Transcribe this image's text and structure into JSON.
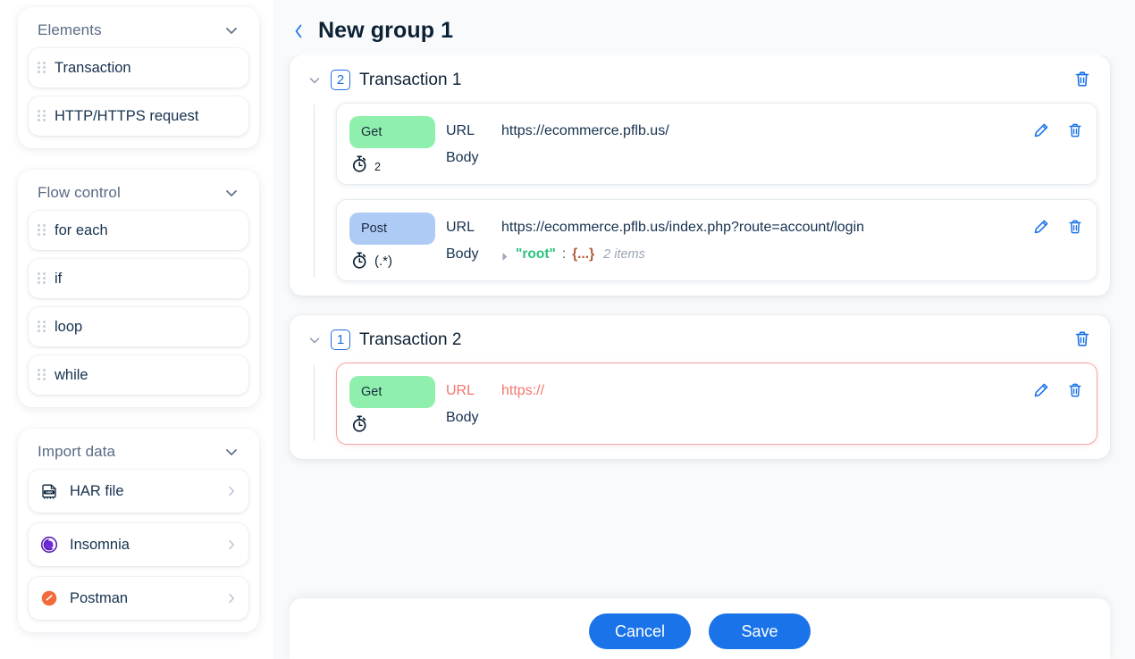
{
  "sidebar": {
    "sections": [
      {
        "title": "Elements",
        "chevron_icon": "chevron-down-icon",
        "items": [
          {
            "label": "Transaction"
          },
          {
            "label": "HTTP/HTTPS request"
          }
        ]
      },
      {
        "title": "Flow control",
        "chevron_icon": "chevron-down-icon",
        "items": [
          {
            "label": "for each"
          },
          {
            "label": "if"
          },
          {
            "label": "loop"
          },
          {
            "label": "while"
          }
        ]
      }
    ],
    "import": {
      "title": "Import data",
      "chevron_icon": "chevron-down-icon",
      "items": [
        {
          "label": "HAR file",
          "icon": "har-file-icon",
          "caret": "chevron-right-icon"
        },
        {
          "label": "Insomnia",
          "icon": "insomnia-icon",
          "caret": "chevron-right-icon"
        },
        {
          "label": "Postman",
          "icon": "postman-icon",
          "caret": "chevron-right-icon"
        }
      ]
    }
  },
  "header": {
    "back_icon": "chevron-left-icon",
    "title": "New group 1"
  },
  "transactions": [
    {
      "badge": "2",
      "name": "Transaction 1",
      "toggle_icon": "chevron-down-icon",
      "delete_icon": "trash-icon",
      "requests": [
        {
          "method": "Get",
          "method_type": "get",
          "timer_icon": "timer-icon",
          "timer_value": "2",
          "url_key": "URL",
          "url_value": "https://ecommerce.pflb.us/",
          "body_key": "Body",
          "body_value": "",
          "has_json_body": false,
          "edit_icon": "pencil-icon",
          "delete_icon": "trash-icon",
          "error": false
        },
        {
          "method": "Post",
          "method_type": "post",
          "timer_icon": "timer-icon",
          "timer_value": "(.*)",
          "url_key": "URL",
          "url_value": "https://ecommerce.pflb.us/index.php?route=account/login",
          "body_key": "Body",
          "has_json_body": true,
          "json_arrow_icon": "triangle-right-icon",
          "json_key": "\"root\"",
          "json_colon": ":",
          "json_braces": "{...}",
          "json_count": "2 items",
          "edit_icon": "pencil-icon",
          "delete_icon": "trash-icon",
          "error": false
        }
      ]
    },
    {
      "badge": "1",
      "name": "Transaction 2",
      "toggle_icon": "chevron-down-icon",
      "delete_icon": "trash-icon",
      "requests": [
        {
          "method": "Get",
          "method_type": "get",
          "timer_icon": "timer-icon",
          "timer_value": "",
          "url_key": "URL",
          "url_value": "https://",
          "body_key": "Body",
          "body_value": "",
          "has_json_body": false,
          "edit_icon": "pencil-icon",
          "delete_icon": "trash-icon",
          "error": true
        }
      ]
    }
  ],
  "footer": {
    "cancel_label": "Cancel",
    "save_label": "Save"
  },
  "colors": {
    "accent": "#1a73e8",
    "get_badge": "#8ef0ac",
    "post_badge": "#aecbf5",
    "error": "#f4756e",
    "error_border": "#f5a3a3",
    "json_key": "#2ec27e",
    "json_braces": "#b05c3c",
    "background": "#f8fafb",
    "text": "#16324f"
  }
}
